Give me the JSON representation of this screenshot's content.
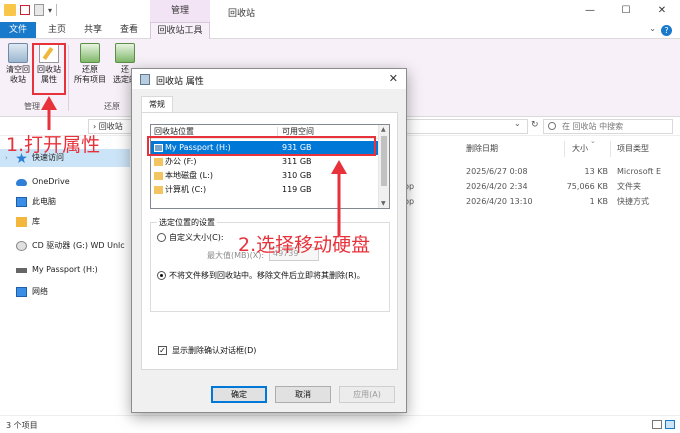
{
  "window": {
    "manage_tab_header": "管理",
    "title": "回收站",
    "minimize": "—",
    "maximize": "☐",
    "close": "✕"
  },
  "ribbon": {
    "tabs": {
      "file": "文件",
      "home": "主页",
      "share": "共享",
      "view": "查看",
      "tools": "回收站工具"
    },
    "buttons": {
      "empty_recycle_bin": [
        "清空回",
        "收站"
      ],
      "properties": [
        "回收站",
        "属性"
      ],
      "restore_all": [
        "还原",
        "所有项目"
      ],
      "restore_selected": [
        "还",
        "选定的"
      ]
    },
    "groups": {
      "manage": "管理",
      "restore": "还原"
    }
  },
  "addressbar": {
    "path": "›  回收站",
    "search_placeholder": "在 回收站 中搜索"
  },
  "navpane": {
    "items": [
      "快速访问",
      "OneDrive",
      "此电脑",
      "库",
      "CD 驱动器 (G:) WD Unlc",
      "My Passport (H:)",
      "网络"
    ]
  },
  "filelist": {
    "headers": {
      "date": "删除日期",
      "size": "大小",
      "type": "项目类型"
    },
    "rows": [
      {
        "name": "",
        "date": "2025/6/27 0:08",
        "size": "13 KB",
        "type": "Microsoft E"
      },
      {
        "name": "top",
        "date": "2026/4/20 2:34",
        "size": "75,066 KB",
        "type": "文件夹"
      },
      {
        "name": "top",
        "date": "2026/4/20 13:10",
        "size": "1 KB",
        "type": "快捷方式"
      }
    ]
  },
  "statusbar": {
    "text": "3 个项目"
  },
  "dialog": {
    "title": "回收站 属性",
    "close": "✕",
    "tab": "常规",
    "list_headers": {
      "location": "回收站位置",
      "space": "可用空间"
    },
    "locations": [
      {
        "name": "My Passport (H:)",
        "space": "931 GB"
      },
      {
        "name": "办公 (F:)",
        "space": "311 GB"
      },
      {
        "name": "本地磁盘 (L:)",
        "space": "310 GB"
      },
      {
        "name": "计算机 (C:)",
        "space": "119 GB"
      }
    ],
    "settings_legend": "选定位置的设置",
    "custom_size": "自定义大小(C):",
    "max_size_label": "最大值(MB)(X):",
    "max_size_value": "49739",
    "no_move": "不将文件移到回收站中。移除文件后立即将其删除(R)。",
    "confirm_delete": "显示删除确认对话框(D)",
    "buttons": {
      "ok": "确定",
      "cancel": "取消",
      "apply": "应用(A)"
    }
  },
  "annotations": {
    "step1": "1.打开属性",
    "step2": "2.选择移动硬盘",
    "color": "#e8323b"
  },
  "colors": {
    "accent": "#0078d7",
    "file_tab": "#1979ca",
    "tools_tint": "#f7f0f8",
    "nav_selected": "#cce4f7"
  }
}
